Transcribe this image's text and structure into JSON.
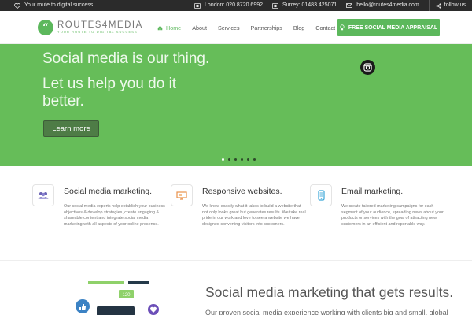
{
  "topbar": {
    "tagline": "Your route to digital success.",
    "london": "London: 020 8720 6992",
    "surrey": "Surrey: 01483 425071",
    "email": "hello@routes4media.com",
    "follow": "follow us"
  },
  "logo": {
    "mark": "“",
    "name": "ROUTES4MEDIA",
    "tagline": "YOUR ROUTE TO DIGITAL SUCCESS"
  },
  "nav": {
    "items": [
      {
        "label": "Home",
        "active": true,
        "icon": "home-icon"
      },
      {
        "label": "About"
      },
      {
        "label": "Services"
      },
      {
        "label": "Partnerships"
      },
      {
        "label": "Blog"
      },
      {
        "label": "Contact"
      }
    ],
    "cta": "FREE SOCIAL MEDIA APPRAISAL"
  },
  "hero": {
    "headline": "Social media is our thing.",
    "subheadline": "Let us help you do it better.",
    "button": "Learn more",
    "slide_count": 6,
    "active_slide": 1
  },
  "features": [
    {
      "icon": "people-icon",
      "title": "Social media marketing.",
      "text": "Our social media experts help establish your business objectives & develop strategies, create engaging & shareable content and integrate social media marketing with all aspects of your online presence."
    },
    {
      "icon": "monitor-icon",
      "title": "Responsive websites.",
      "text": "We know exactly what it takes to build a website that not only looks great but generates results. We take real pride in our work and love to see a website we have designed converting visitors into customers."
    },
    {
      "icon": "mobile-icon",
      "title": "Email marketing.",
      "text": "We create tailored marketing campaigns for each segment of your audience, spreading news about your products or services with the goal of attracting new customers in an efficient and reportable way."
    }
  ],
  "lower": {
    "title": "Social media marketing that gets results.",
    "text": "Our proven social media experience working with clients big and small, global",
    "badge": "120"
  },
  "colors": {
    "brand_green": "#5cb85c",
    "hero_green": "#66bd59",
    "topbar": "#2b2b2b"
  }
}
